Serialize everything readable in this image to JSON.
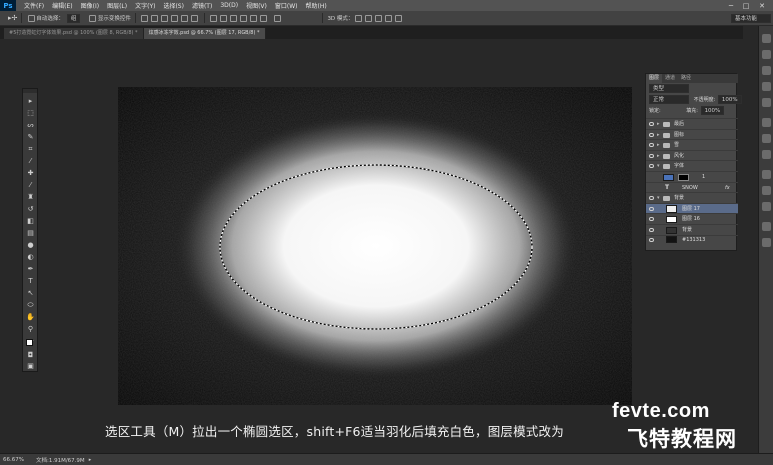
{
  "app": {
    "logo": "Ps"
  },
  "menu": [
    "文件(F)",
    "编辑(E)",
    "图像(I)",
    "图层(L)",
    "文字(Y)",
    "选择(S)",
    "滤镜(T)",
    "3D(D)",
    "视图(V)",
    "窗口(W)",
    "帮助(H)"
  ],
  "window_controls": [
    "─",
    "□",
    "✕"
  ],
  "options_bar": {
    "auto_select_label": "自动选择：",
    "auto_select_value": "组",
    "show_transform_label": "显示变换控件",
    "mode3d_label": "3D 模式：",
    "workspace_value": "基本功能"
  },
  "tabs": [
    {
      "label": "#5打造霓虹灯字体效果.psd @ 100% (图层 8, RGB/8) *",
      "active": false
    },
    {
      "label": "炫感冰冻字效.psd @ 66.7% (图层 17, RGB/8) *",
      "active": true
    }
  ],
  "layers_panel": {
    "tabs": [
      "图层",
      "通道",
      "路径"
    ],
    "filter_label": "类型",
    "blend_mode": "正常",
    "opacity_label": "不透明度:",
    "opacity_value": "100%",
    "lock_label": "锁定:",
    "fill_label": "填充:",
    "fill_value": "100%",
    "layers": [
      {
        "name": "最后",
        "type": "group",
        "visible": true,
        "selected": false
      },
      {
        "name": "图标",
        "type": "group",
        "visible": true,
        "selected": false
      },
      {
        "name": "雪",
        "type": "group",
        "visible": true,
        "selected": false
      },
      {
        "name": "风化",
        "type": "group",
        "visible": true,
        "selected": false
      },
      {
        "name": "字体",
        "type": "group-open",
        "visible": true,
        "selected": false
      },
      {
        "name": "1",
        "type": "layer-mask",
        "visible": false,
        "selected": false
      },
      {
        "name": "SNOW",
        "type": "text",
        "visible": false,
        "selected": false
      },
      {
        "name": "背景",
        "type": "group-open",
        "visible": true,
        "selected": false
      },
      {
        "name": "图层 17",
        "type": "layer",
        "visible": true,
        "selected": true
      },
      {
        "name": "图层 16",
        "type": "layer",
        "visible": true,
        "selected": false
      },
      {
        "name": "背景",
        "type": "layer",
        "visible": true,
        "selected": false
      },
      {
        "name": "#131313",
        "type": "fill",
        "visible": true,
        "selected": false
      }
    ]
  },
  "caption": "选区工具（M）拉出一个椭圆选区，shift+F6适当羽化后填充白色，图层模式改为",
  "watermark": {
    "top": "fevte.com",
    "bottom": "飞特教程网"
  },
  "status": {
    "zoom": "66.67%",
    "doc": "文档:1.91M/67.9M"
  },
  "colors": {
    "selection_layer": "#5a6b8a",
    "canvas_bg": "#161616",
    "glow": "#ffffff"
  }
}
